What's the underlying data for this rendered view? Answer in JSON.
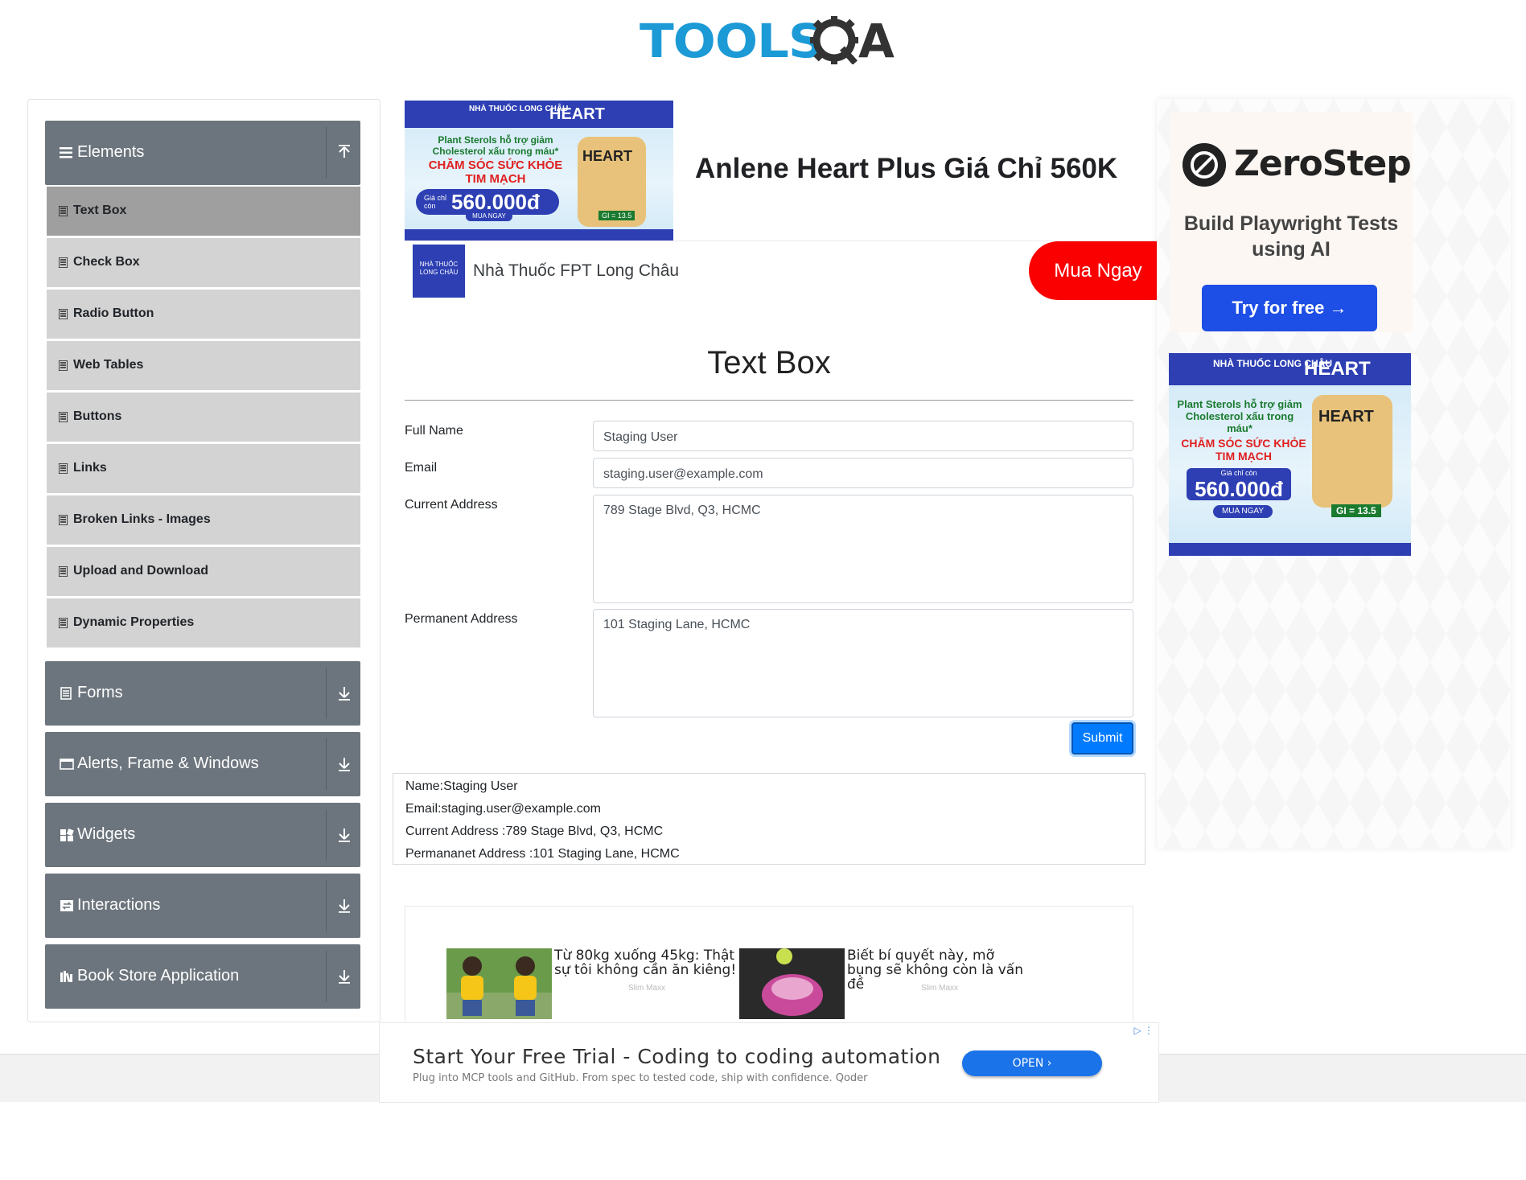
{
  "logo": {
    "part1": "TOOLS",
    "part2": "A"
  },
  "sidebar": {
    "groups": [
      {
        "label": "Elements",
        "icon": "hamburger-icon",
        "arrow": "arrow-up-icon",
        "expanded": true
      },
      {
        "label": "Forms",
        "icon": "form-icon",
        "arrow": "arrow-down-icon"
      },
      {
        "label": "Alerts, Frame & Windows",
        "icon": "window-icon",
        "arrow": "arrow-down-icon"
      },
      {
        "label": "Widgets",
        "icon": "widgets-icon",
        "arrow": "arrow-down-icon"
      },
      {
        "label": "Interactions",
        "icon": "interactions-icon",
        "arrow": "arrow-down-icon"
      },
      {
        "label": "Book Store Application",
        "icon": "book-icon",
        "arrow": "arrow-down-icon"
      }
    ],
    "items": [
      {
        "label": "Text Box",
        "active": true
      },
      {
        "label": "Check Box"
      },
      {
        "label": "Radio Button"
      },
      {
        "label": "Web Tables"
      },
      {
        "label": "Buttons"
      },
      {
        "label": "Links"
      },
      {
        "label": "Broken Links - Images"
      },
      {
        "label": "Upload and Download"
      },
      {
        "label": "Dynamic Properties"
      }
    ]
  },
  "ad_top": {
    "banner": {
      "brand_line": "NHÀ THUỐC LONG CHÂU",
      "product": "HEART",
      "line1": "Plant Sterols hỗ trợ giảm Cholesterol xấu trong máu*",
      "line2": "CHĂM SÓC SỨC KHỎE TIM MẠCH",
      "price_label": "Giá chỉ còn",
      "price": "560.000đ",
      "buy": "MUA NGAY",
      "can_label": "HEART",
      "gi": "GI = 13.5"
    },
    "title": "Anlene Heart Plus Giá Chỉ 560K",
    "logo_text": "NHÀ THUỐC LONG CHÂU",
    "advertiser": "Nhà Thuốc FPT Long Châu",
    "cta": "Mua Ngay"
  },
  "page": {
    "title": "Text Box"
  },
  "form": {
    "full_name_label": "Full Name",
    "full_name_value": "Staging User",
    "email_label": "Email",
    "email_value": "staging.user@example.com",
    "current_address_label": "Current Address",
    "current_address_value": "789 Stage Blvd, Q3, HCMC",
    "permanent_address_label": "Permanent Address",
    "permanent_address_value": "101 Staging Lane, HCMC",
    "submit_label": "Submit"
  },
  "output": {
    "name": "Name:Staging User",
    "email": "Email:staging.user@example.com",
    "current_address": "Current Address :789 Stage Blvd, Q3, HCMC",
    "permanent_address": "Permananet Address :101 Staging Lane, HCMC"
  },
  "native_ad": {
    "items": [
      {
        "title": "Từ 80kg xuống 45kg: Thật sự tôi không cần ăn kiêng!",
        "source": "Slim Maxx"
      },
      {
        "title": "Biết bí quyết này, mỡ bụng sẽ không còn là vấn đề",
        "source": "Slim Maxx"
      }
    ]
  },
  "anchor_ad": {
    "title": "Start Your Free Trial - Coding to coding automation",
    "subtitle": "Plug into MCP tools and GitHub. From spec to tested code, ship with confidence. Qoder",
    "cta": "OPEN ›"
  },
  "right_ads": {
    "zerostep": {
      "name": "ZeroStep",
      "tagline": "Build Playwright Tests using AI",
      "cta": "Try for free →"
    },
    "banner": {
      "brand_line": "NHÀ THUỐC LONG CHÂU",
      "product": "HEART",
      "line1": "Plant Sterols hỗ trợ giảm Cholesterol xấu trong máu*",
      "line2": "CHĂM SÓC SỨC KHỎE TIM MẠCH",
      "price_label": "Giá chỉ còn",
      "price": "560.000đ",
      "buy": "MUA NGAY",
      "can_label": "HEART",
      "gi": "GI = 13.5"
    }
  },
  "colors": {
    "group_header": "#6c757d",
    "menu_item": "#d3d3d3",
    "menu_item_active": "#9f9f9f",
    "submit": "#007bff",
    "logo_blue": "#1c9ad6",
    "ad_cta": "#fb0000"
  }
}
